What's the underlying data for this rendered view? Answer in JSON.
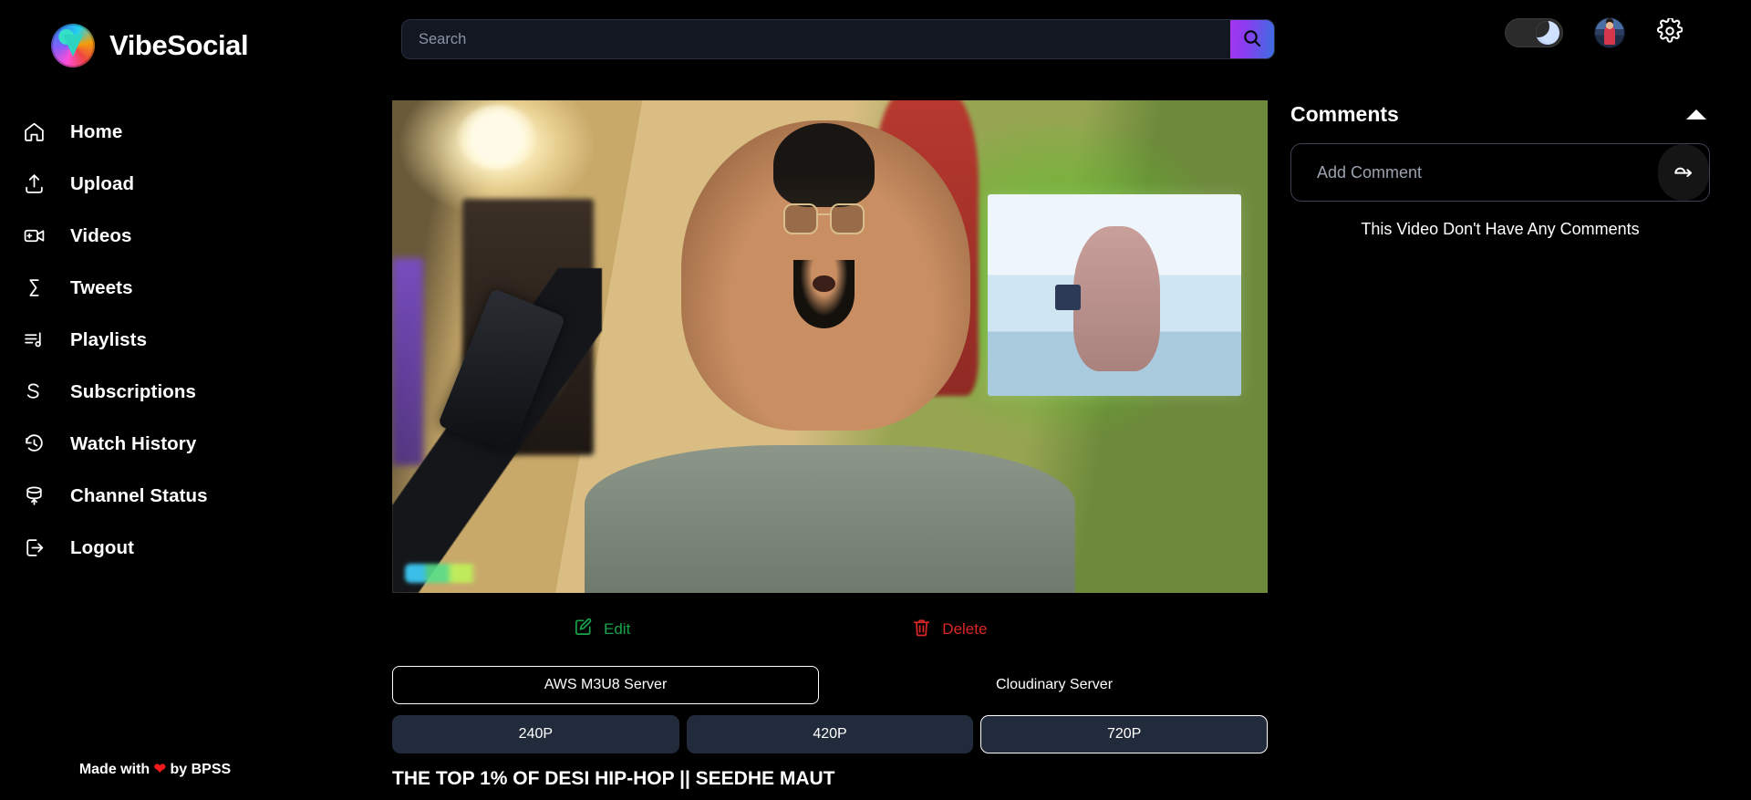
{
  "brand": {
    "name": "VibeSocial",
    "logo_icon": "vibesocial-logo"
  },
  "sidebar": {
    "items": [
      {
        "label": "Home",
        "icon": "home-icon"
      },
      {
        "label": "Upload",
        "icon": "upload-icon"
      },
      {
        "label": "Videos",
        "icon": "video-camera-icon"
      },
      {
        "label": "Tweets",
        "icon": "tweets-icon"
      },
      {
        "label": "Playlists",
        "icon": "playlist-icon"
      },
      {
        "label": "Subscriptions",
        "icon": "subscriptions-icon"
      },
      {
        "label": "Watch History",
        "icon": "history-clock-icon"
      },
      {
        "label": "Channel Status",
        "icon": "database-stats-icon"
      },
      {
        "label": "Logout",
        "icon": "logout-icon"
      }
    ],
    "footer": {
      "prefix": "Made with",
      "heart": "❤",
      "suffix": "by BPSS"
    }
  },
  "header": {
    "search": {
      "placeholder": "Search",
      "value": "",
      "button_icon": "search-icon"
    },
    "dark_mode_toggle": {
      "icon": "moon-icon",
      "state": "on"
    },
    "avatar_icon": "user-avatar",
    "settings_icon": "gear-icon"
  },
  "video": {
    "title": "THE TOP 1% OF DESI HIP-HOP || SEEDHE MAUT",
    "actions": {
      "edit": {
        "label": "Edit",
        "icon": "pencil-square-icon",
        "color": "#17a34a"
      },
      "delete": {
        "label": "Delete",
        "icon": "trash-icon",
        "color": "#dc2626"
      }
    },
    "servers": [
      {
        "label": "AWS M3U8 Server",
        "selected": true
      },
      {
        "label": "Cloudinary Server",
        "selected": false
      }
    ],
    "qualities": [
      {
        "label": "240P",
        "selected": false
      },
      {
        "label": "420P",
        "selected": false
      },
      {
        "label": "720P",
        "selected": true
      }
    ]
  },
  "comments": {
    "title": "Comments",
    "collapse_icon": "chevron-up-icon",
    "input_placeholder": "Add Comment",
    "input_value": "",
    "send_icon": "send-comment-icon",
    "empty_message": "This Video Don't Have Any Comments"
  },
  "colors": {
    "background": "#000000",
    "accent_gradient_start": "#a435f0",
    "accent_gradient_end": "#3b6fe0",
    "edit_green": "#17a34a",
    "delete_red": "#dc2626",
    "quality_button_bg": "#222b3b",
    "search_bg": "#121722"
  }
}
